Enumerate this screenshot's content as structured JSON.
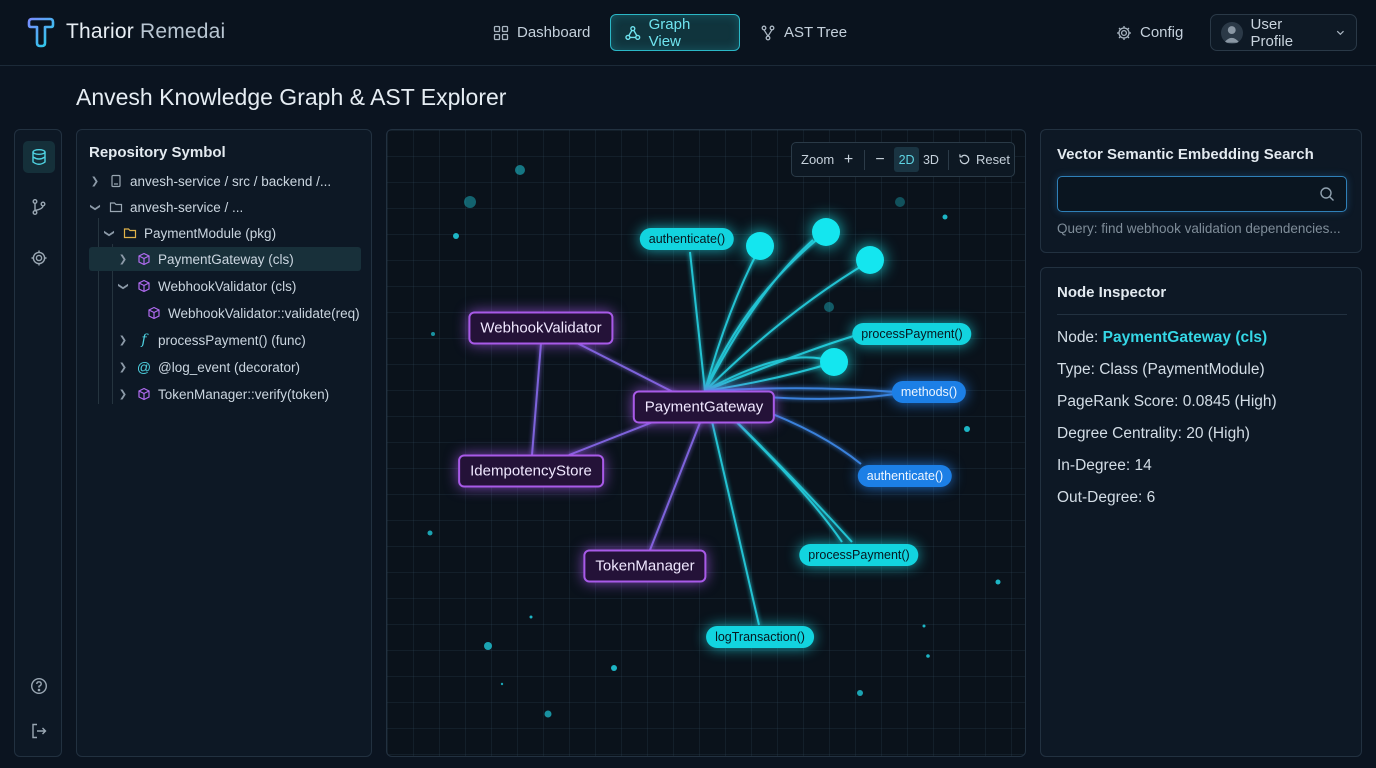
{
  "app": {
    "brand_bold": "Tharior",
    "brand_light": "Remedai"
  },
  "nav": {
    "dashboard": "Dashboard",
    "graph_view": "Graph View",
    "ast_tree": "AST Tree",
    "config": "Config",
    "user_profile": "User Profile"
  },
  "page": {
    "title": "Anvesh Knowledge Graph & AST Explorer"
  },
  "rail": {
    "icons": [
      "database-icon",
      "branch-icon",
      "gear-icon",
      "help-icon",
      "logout-icon"
    ]
  },
  "tree": {
    "heading": "Repository Symbol",
    "items": [
      {
        "label": "anvesh-service / src / backend /...",
        "icon": "file-icon",
        "chevron": "right"
      },
      {
        "label": "anvesh-service / ...",
        "icon": "folder-icon",
        "chevron": "down"
      },
      {
        "label": "PaymentModule (pkg)",
        "icon": "folder-icon",
        "chevron": "down"
      },
      {
        "label": "PaymentGateway (cls)",
        "icon": "cube-icon",
        "chevron": "right",
        "selected": true
      },
      {
        "label": "WebhookValidator (cls)",
        "icon": "cube-icon",
        "chevron": "down"
      },
      {
        "label": "WebhookValidator::validate(req)",
        "icon": "cube-icon",
        "chevron": "none"
      },
      {
        "label": "processPayment() (func)",
        "icon": "function-icon",
        "chevron": "right"
      },
      {
        "label": "@log_event (decorator)",
        "icon": "at-icon",
        "chevron": "right"
      },
      {
        "label": "TokenManager::verify(token)",
        "icon": "cube-icon",
        "chevron": "right"
      }
    ]
  },
  "graph": {
    "zoom_label": "Zoom",
    "zoom_in": "+",
    "zoom_out": "−",
    "mode_2d": "2D",
    "mode_3d": "3D",
    "reset": "Reset",
    "active_mode": "2D",
    "nodes": {
      "payment_gateway": "PaymentGateway",
      "webhook_validator": "WebhookValidator",
      "idempotency_store": "IdempotencyStore",
      "token_manager": "TokenManager",
      "authenticate_top": "authenticate()",
      "process_payment_right": "processPayment()",
      "methods": "methods()",
      "authenticate_right": "authenticate()",
      "process_payment_bottom": "processPayment()",
      "log_transaction": "logTransaction()"
    },
    "colors": {
      "cyan": "#12d4df",
      "blue": "#1c7fe6",
      "purple": "#a85ae8"
    }
  },
  "search": {
    "heading": "Vector Semantic Embedding Search",
    "value": "",
    "hint": "Query: find webhook validation dependencies..."
  },
  "inspector": {
    "heading": "Node Inspector",
    "node_prefix": "Node: ",
    "node_value": "PaymentGateway (cls)",
    "type": "Type: Class (PaymentModule)",
    "pagerank": "PageRank Score: 0.0845 (High)",
    "degree": "Degree Centrality: 20 (High)",
    "in_degree": "In-Degree: 14",
    "out_degree": "Out-Degree: 6"
  }
}
